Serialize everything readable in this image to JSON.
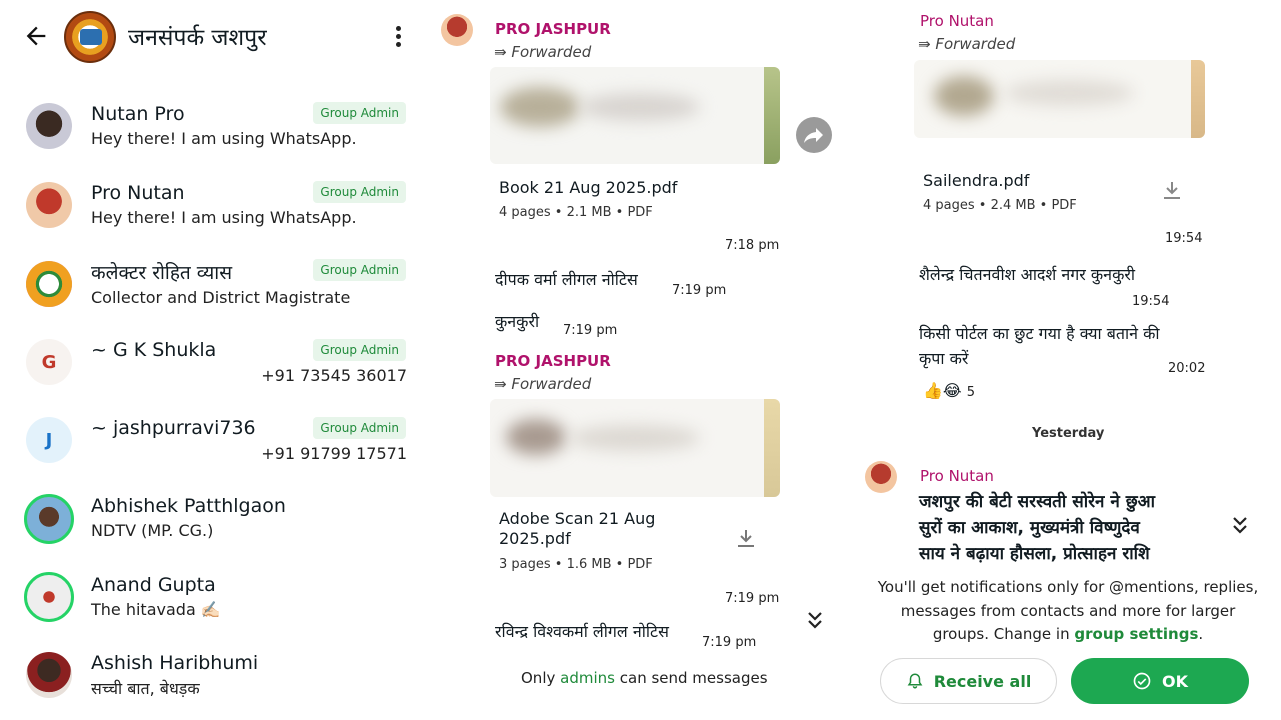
{
  "header": {
    "title": "जनसंपर्क जशपुर"
  },
  "members": [
    {
      "name": "Nutan Pro",
      "subtitle": "Hey there! I am using WhatsApp.",
      "badge": "Group Admin"
    },
    {
      "name": "Pro Nutan",
      "subtitle": "Hey there! I am using WhatsApp.",
      "badge": "Group Admin"
    },
    {
      "name": "कलेक्टर रोहित व्यास",
      "subtitle": "Collector and District Magistrate",
      "badge": "Group Admin"
    },
    {
      "name": "~ G K Shukla",
      "phone": "+91 73545 36017",
      "badge": "Group Admin",
      "letter": "G"
    },
    {
      "name": "~ jashpurravi736",
      "phone": "+91 91799 17571",
      "badge": "Group Admin",
      "letter": "J"
    },
    {
      "name": "Abhishek Patthlgaon",
      "subtitle": "NDTV (MP. CG.)"
    },
    {
      "name": "Anand Gupta",
      "subtitle": "The hitavada ✍🏻"
    },
    {
      "name": "Ashish Haribhumi",
      "subtitle": "सच्ची बात, बेधड़क"
    }
  ],
  "chat1": {
    "msg1": {
      "sender": "PRO JASHPUR",
      "forwarded": "Forwarded",
      "file": "Book 21 Aug 2025.pdf",
      "meta": "4 pages • 2.1 MB • PDF",
      "time": "7:18 pm"
    },
    "msg2": {
      "text": "दीपक वर्मा लीगल नोटिस",
      "time": "7:19 pm"
    },
    "msg3": {
      "text": "कुनकुरी",
      "time": "7:19 pm"
    },
    "msg4": {
      "sender": "PRO JASHPUR",
      "forwarded": "Forwarded",
      "file_line1": "Adobe Scan 21 Aug",
      "file_line2": "2025.pdf",
      "meta": "3 pages • 1.6 MB • PDF",
      "time": "7:19 pm"
    },
    "msg5": {
      "text": "रविन्द्र विश्वकर्मा लीगल नोटिस",
      "time": "7:19 pm"
    },
    "footer": {
      "prefix": "Only",
      "admins": "admins",
      "suffix": "can send messages"
    }
  },
  "chat2": {
    "msg1": {
      "sender": "Pro Nutan",
      "forwarded": "Forwarded",
      "file": "Sailendra.pdf",
      "meta": "4 pages • 2.4 MB • PDF",
      "time": "19:54"
    },
    "msg2": {
      "text": "शैलेन्द्र चितनवीश आदर्श नगर कुनकुरी",
      "time": "19:54"
    },
    "msg3": {
      "line1": "किसी पोर्टल का छुट गया है क्या बताने की",
      "line2": "कृपा करें",
      "time": "20:02",
      "reactions": "👍😂",
      "reaction_count": "5"
    },
    "date_separator": "Yesterday",
    "msg4": {
      "sender": "Pro Nutan",
      "line1": "जशपुर की बेटी सरस्वती सोरेन ने छुआ",
      "line2": "सुरों का आकाश, मुख्यमंत्री विष्णुदेव",
      "line3": "साय ने बढ़ाया हौसला, प्रोत्साहन राशि"
    },
    "notice": {
      "line1": "You'll get notifications only for @mentions, replies,",
      "line2": "messages from contacts and more for larger",
      "line3_prefix": "groups. Change in",
      "link": "group settings",
      "line3_suffix": "."
    },
    "receive_all": "Receive all",
    "ok": "OK"
  },
  "colors": {
    "accent_green": "#1da851",
    "sender_magenta": "#b0126b",
    "badge_bg": "#e7f5ea"
  }
}
